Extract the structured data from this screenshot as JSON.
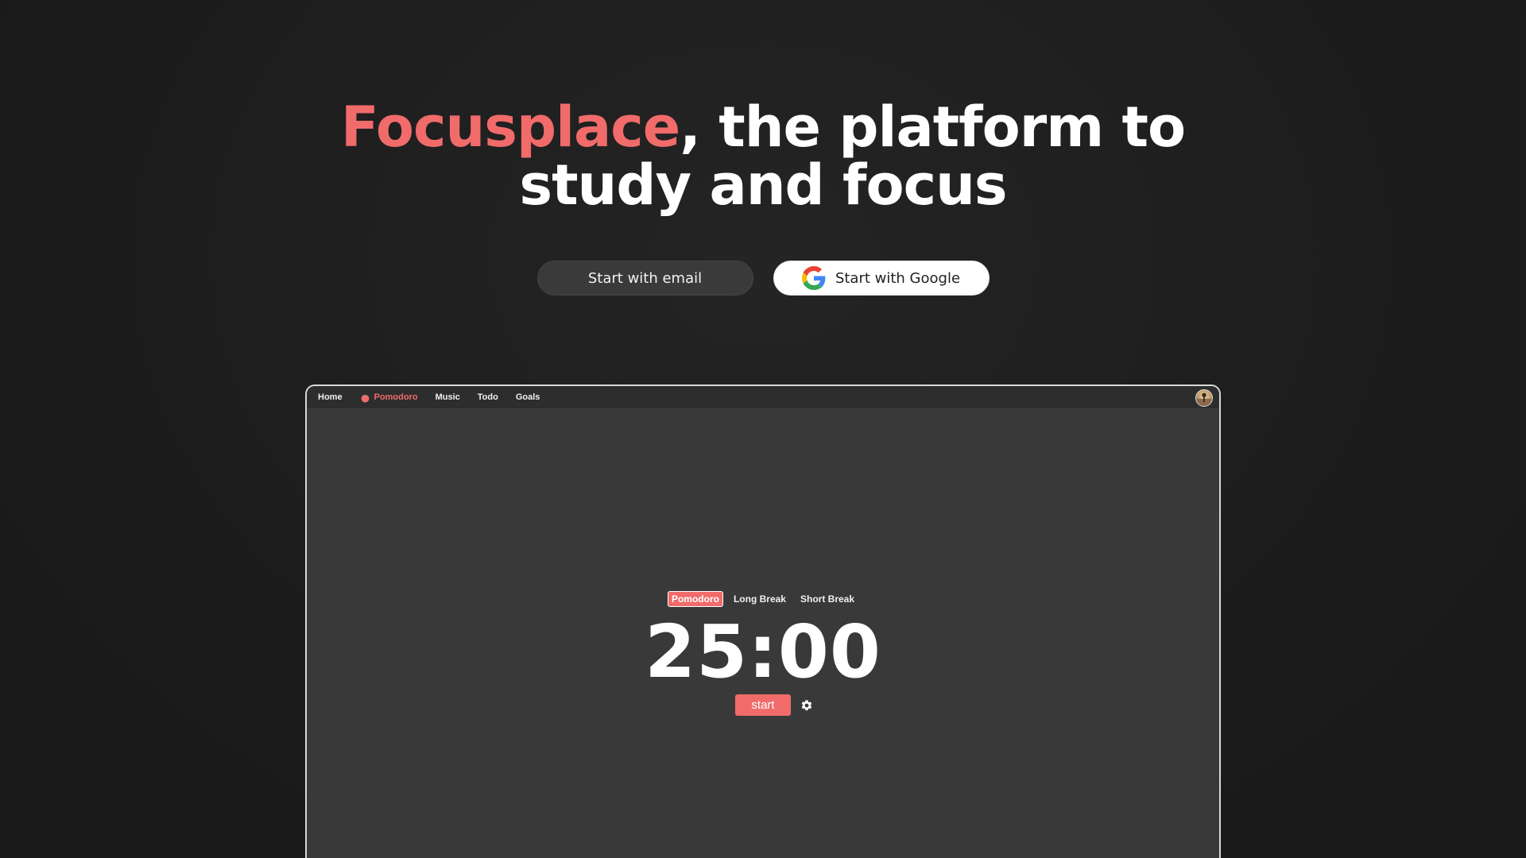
{
  "hero": {
    "brand": "Focusplace",
    "title_line1_rest": ", the platform to",
    "title_line2": "study and focus"
  },
  "cta": {
    "email_label": "Start with email",
    "google_label": "Start with Google",
    "google_icon": "google-g-icon"
  },
  "app_preview": {
    "nav": [
      {
        "label": "Home",
        "active": false
      },
      {
        "label": "Pomodoro",
        "active": true,
        "icon": "tomato-icon"
      },
      {
        "label": "Music",
        "active": false
      },
      {
        "label": "Todo",
        "active": false
      },
      {
        "label": "Goals",
        "active": false
      }
    ],
    "avatar_icon": "user-avatar",
    "modes": [
      {
        "label": "Pomodoro",
        "active": true
      },
      {
        "label": "Long Break",
        "active": false
      },
      {
        "label": "Short Break",
        "active": false
      }
    ],
    "timer": "25:00",
    "start_label": "start",
    "settings_icon": "gear-icon"
  },
  "colors": {
    "accent": "#f16b6b",
    "background": "#1c1c1c",
    "panel": "#393939",
    "topbar": "#2d2d2d"
  }
}
